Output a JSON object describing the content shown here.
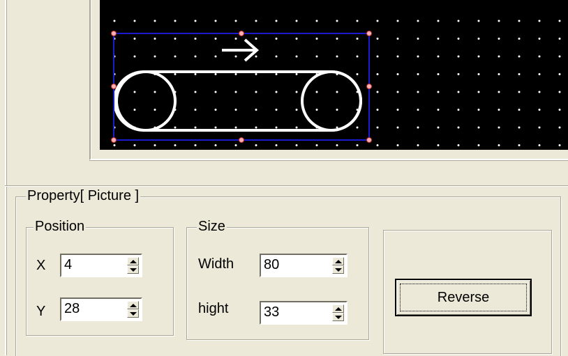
{
  "property_panel": {
    "title": "Property[ Picture ]",
    "position": {
      "legend": "Position",
      "x_label": "X",
      "x_value": "4",
      "y_label": "Y",
      "y_value": "28"
    },
    "size": {
      "legend": "Size",
      "width_label": "Width",
      "width_value": "80",
      "height_label": "hight",
      "height_value": "33"
    },
    "reverse_button": "Reverse"
  },
  "colors": {
    "canvas_background": "#000000",
    "selection_border": "#1a1ad0",
    "handle": "#ffb0b0",
    "grid_dot": "#ffffff"
  }
}
